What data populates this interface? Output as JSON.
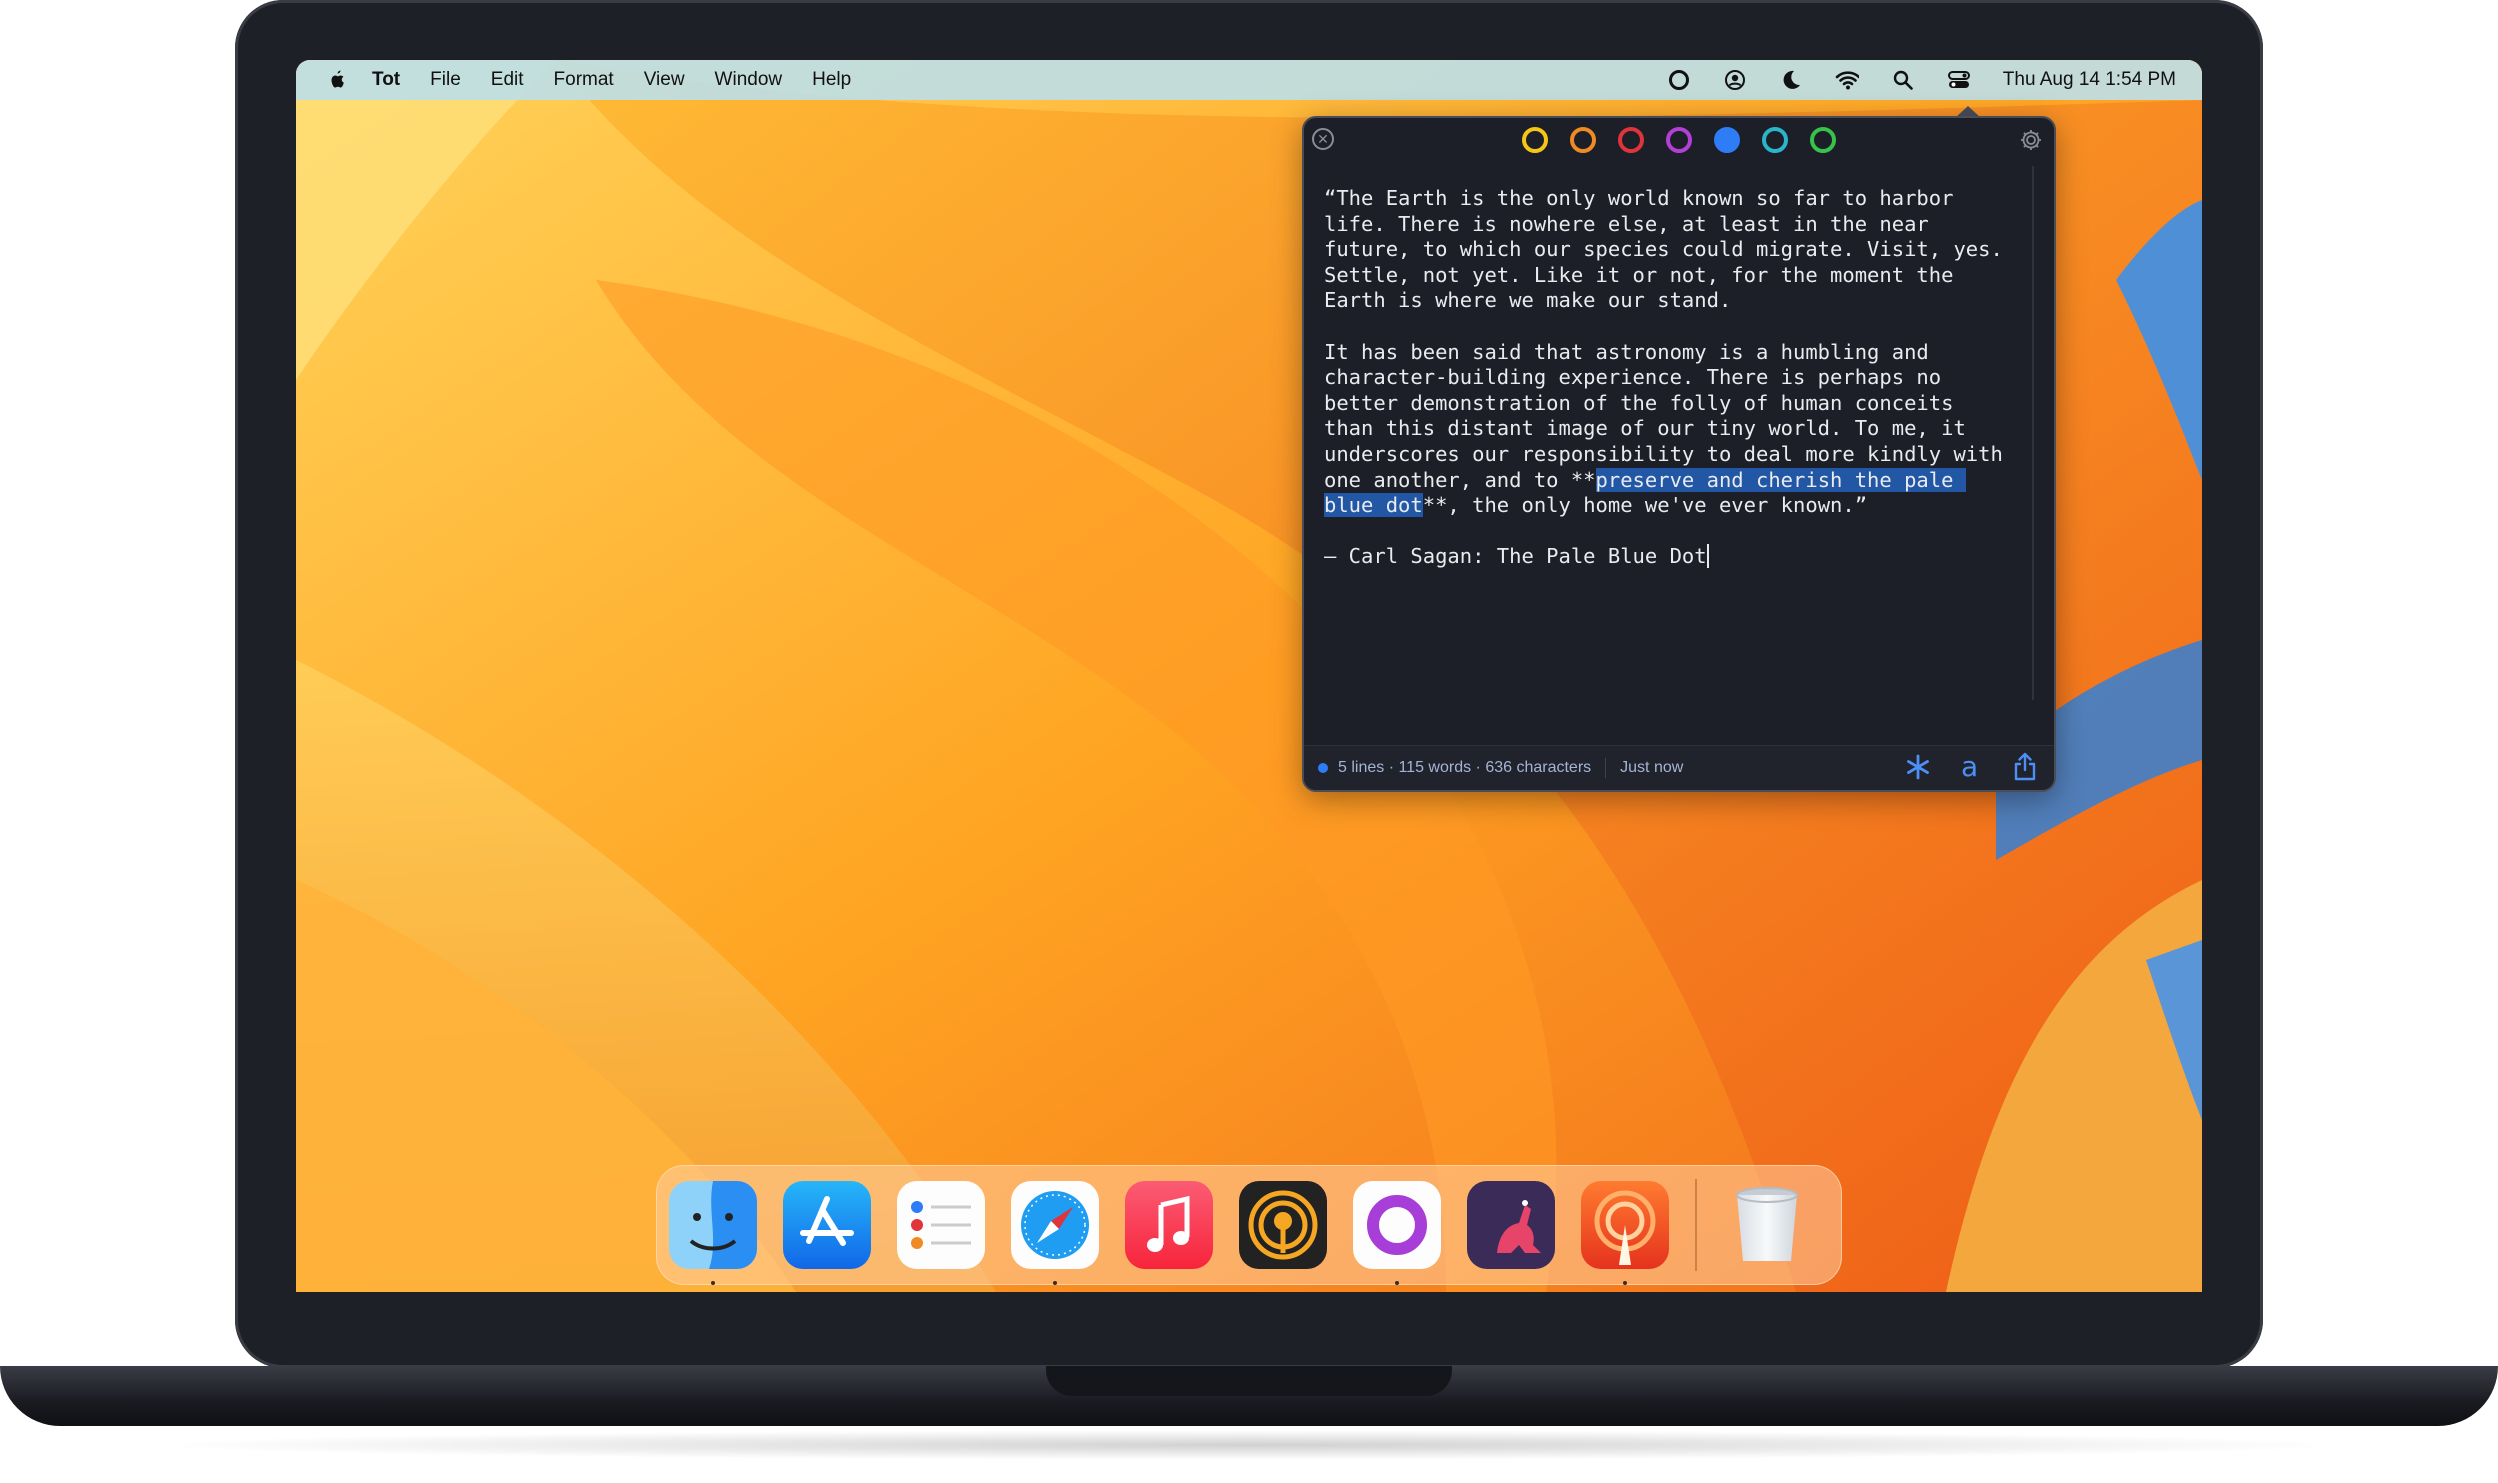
{
  "menubar": {
    "apple_menu": "apple-logo",
    "app_name": "Tot",
    "menus": [
      "File",
      "Edit",
      "Format",
      "View",
      "Window",
      "Help"
    ],
    "status_icons": [
      "tot-icon",
      "user-icon",
      "moon-icon",
      "wifi-icon",
      "search-icon",
      "control-center-icon"
    ],
    "clock": "Thu Aug 14  1:54 PM"
  },
  "tot": {
    "dot_colors": [
      "#f5c518",
      "#f08a24",
      "#e0343c",
      "#b23fd6",
      "#2e7cf6",
      "#2bb5c9",
      "#37c24a"
    ],
    "selected_dot": 4,
    "paragraph1": "“The Earth is the only world known so far to harbor life. There is nowhere else, at least in the near future, to which our species could migrate. Visit, yes. Settle, not yet. Like it or not, for the moment the Earth is where we make our stand.",
    "paragraph2_before": "It has been said that astronomy is a humbling and character-building experience. There is perhaps no better demonstration of the folly of human conceits than this distant image of our tiny world. To me, it underscores our responsibility to deal more kindly with one another, and to **",
    "paragraph2_highlight": "preserve and cherish the pale blue dot",
    "paragraph2_after": "**, the only home we've ever known.”",
    "attribution": "— Carl Sagan: The Pale Blue Dot",
    "stats": "5 lines · 115 words · 636 characters",
    "saved": "Just now"
  },
  "dock": {
    "apps": [
      "finder-icon",
      "app-store-icon",
      "reminders-icon",
      "safari-icon",
      "music-icon",
      "overcast-icon",
      "tot-icon",
      "kangaroo-icon",
      "castro-icon",
      "trash-icon"
    ]
  }
}
